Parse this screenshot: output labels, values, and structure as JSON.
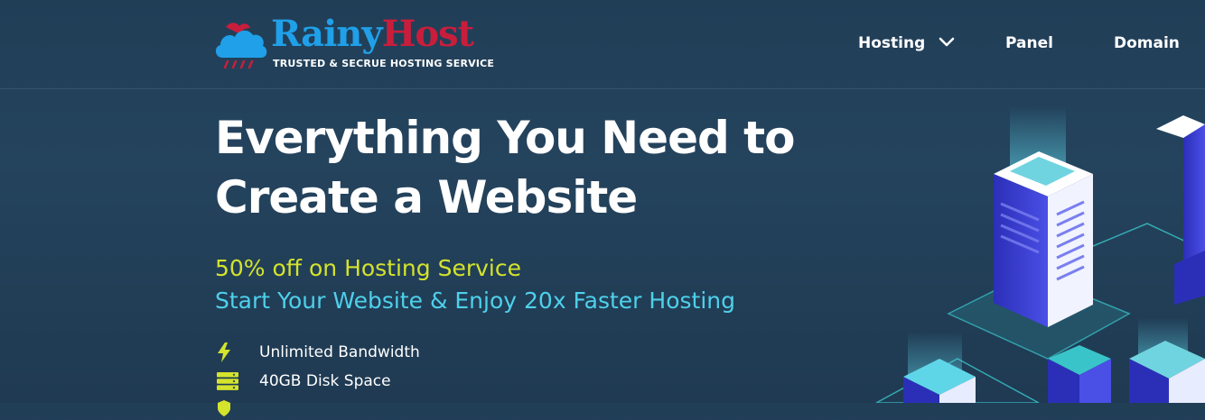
{
  "brand": {
    "name_part1": "Rainy",
    "name_part2": "Host",
    "tagline": "TRUSTED & SECRUE HOSTING SERVICE",
    "colors": {
      "primary": "#1fa0e8",
      "secondary": "#c81e3c"
    }
  },
  "nav": {
    "items": [
      {
        "label": "Hosting",
        "icon": "chevron-down-icon"
      },
      {
        "label": "Panel"
      },
      {
        "label": "Domain"
      }
    ]
  },
  "hero": {
    "title_line1": "Everything You Need to",
    "title_line2": "Create a Website",
    "offer": "50% off on Hosting Service",
    "tagline": "Start Your Website & Enjoy 20x Faster Hosting",
    "features": [
      {
        "icon": "bolt-icon",
        "label": "Unlimited Bandwidth"
      },
      {
        "icon": "server-icon",
        "label": "40GB Disk Space"
      },
      {
        "icon": "shield-icon",
        "label": ""
      }
    ]
  },
  "colors": {
    "background": "#213e57",
    "offer": "#d4e32c",
    "tagline": "#4fd0ea",
    "server_blue": "#3a3fd8",
    "server_teal": "#39c4c9"
  }
}
